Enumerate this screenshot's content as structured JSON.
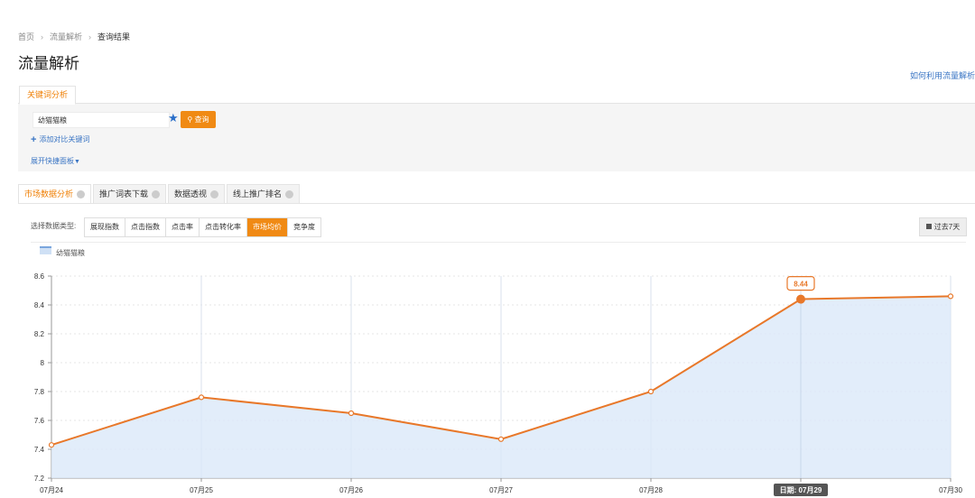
{
  "breadcrumb": {
    "home": "首页",
    "section": "流量解析",
    "current": "查询结果"
  },
  "page_title": "流量解析",
  "help_link": "如何利用流量解析",
  "search": {
    "tab_label": "关键词分析",
    "keyword_value": "幼猫猫粮",
    "query_button": "查询",
    "add_compare": "添加对比关键词",
    "expand_panel": "展开快捷面板"
  },
  "tabs": [
    {
      "label": "市场数据分析"
    },
    {
      "label": "推广词表下载"
    },
    {
      "label": "数据透视"
    },
    {
      "label": "线上推广排名"
    }
  ],
  "data_type": {
    "label": "选择数据类型:",
    "options": [
      "展现指数",
      "点击指数",
      "点击率",
      "点击转化率",
      "市场均价",
      "竞争度"
    ],
    "selected": "市场均价"
  },
  "period_button": "过去7天",
  "colors": {
    "accent": "#f08a14",
    "line": "#e8782a",
    "area": "#dbe8f9",
    "link": "#3a75c4"
  },
  "chart_data": {
    "type": "area",
    "title": "",
    "xlabel": "",
    "ylabel": "",
    "x": [
      "07月24",
      "07月25",
      "07月26",
      "07月27",
      "07月28",
      "07月29",
      "07月30"
    ],
    "series": [
      {
        "name": "幼猫猫粮",
        "values": [
          7.43,
          7.76,
          7.65,
          7.47,
          7.8,
          8.44,
          8.46
        ]
      }
    ],
    "yticks": [
      7.2,
      7.4,
      7.6,
      7.8,
      8,
      8.2,
      8.4,
      8.6
    ],
    "ylim": [
      7.2,
      8.6
    ],
    "grid": true,
    "legend": "top-left",
    "tooltip": {
      "value_label": "8.44",
      "date_label": "日期: 07月29"
    }
  }
}
